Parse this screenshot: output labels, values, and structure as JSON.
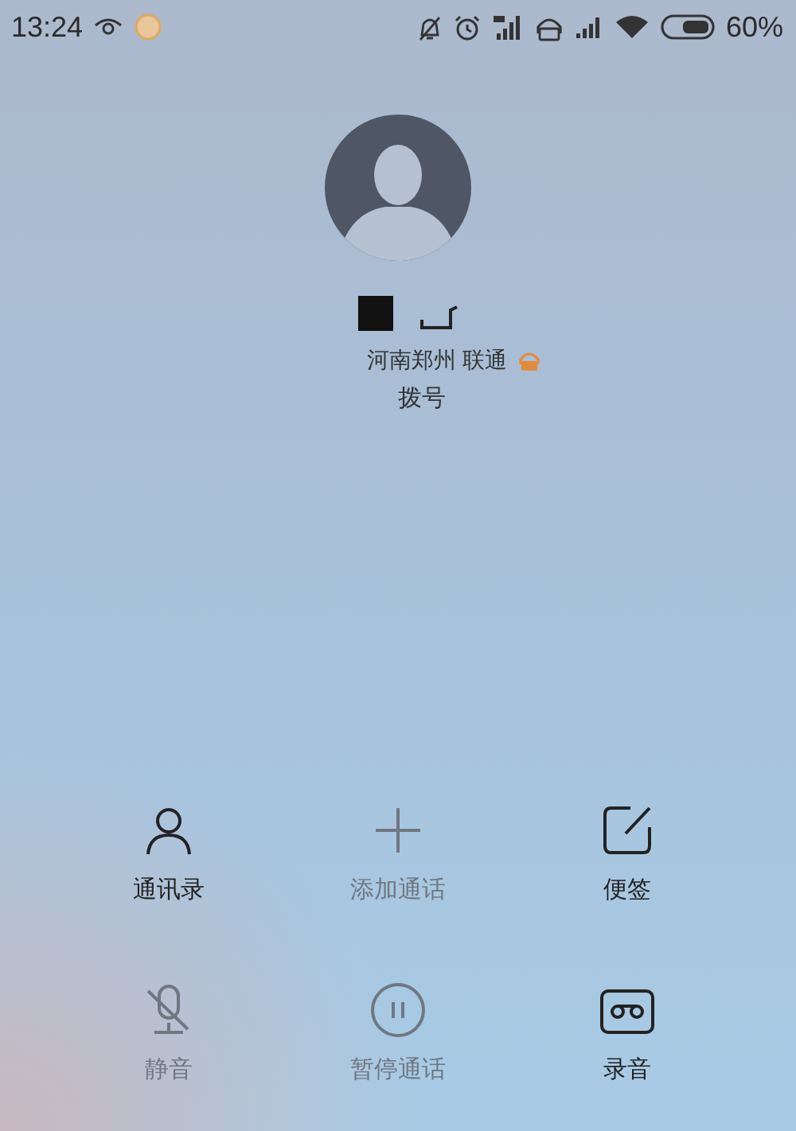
{
  "status_bar": {
    "time": "13:24",
    "battery_text": "60%"
  },
  "caller": {
    "location": "河南郑州 联通",
    "state": "拨号"
  },
  "actions": [
    {
      "kind": "contacts",
      "label": "通讯录",
      "disabled": false
    },
    {
      "kind": "add",
      "label": "添加通话",
      "disabled": true
    },
    {
      "kind": "note",
      "label": "便签",
      "disabled": false
    },
    {
      "kind": "mute",
      "label": "静音",
      "disabled": true
    },
    {
      "kind": "hold",
      "label": "暂停通话",
      "disabled": true
    },
    {
      "kind": "record",
      "label": "录音",
      "disabled": false
    }
  ]
}
